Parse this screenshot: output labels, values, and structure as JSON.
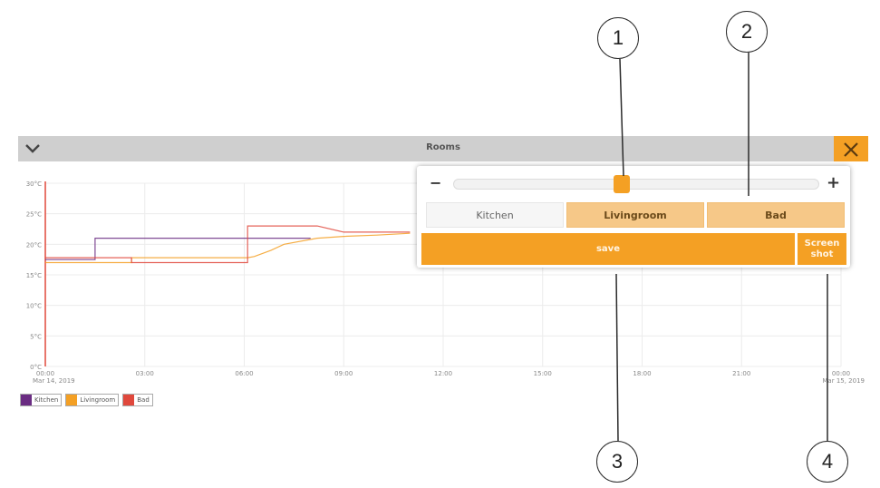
{
  "panel": {
    "title": "Rooms"
  },
  "controls": {
    "zoom_minus": "−",
    "zoom_plus": "+",
    "zoom_level": 0.46,
    "tabs": [
      {
        "label": "Kitchen",
        "selected": false
      },
      {
        "label": "Livingroom",
        "selected": true
      },
      {
        "label": "Bad",
        "selected": true
      }
    ],
    "save_label": "save",
    "screenshot_label": "Screen\nshot"
  },
  "callouts": [
    "1",
    "2",
    "3",
    "4"
  ],
  "colors": {
    "accent": "#f4a024",
    "header": "#cfcfcf",
    "kitchen": "#6a2c82",
    "livingroom": "#f4a024",
    "bad": "#e0483c"
  },
  "icons": {
    "collapse": "chevron-down-icon",
    "close": "close-icon"
  },
  "chart_data": {
    "type": "line",
    "y_ticks": [
      "0°C",
      "5°C",
      "10°C",
      "15°C",
      "20°C",
      "25°C",
      "30°C"
    ],
    "x_ticks": [
      "00:00",
      "03:00",
      "06:00",
      "09:00",
      "12:00",
      "15:00",
      "18:00",
      "21:00",
      "00:00"
    ],
    "x_start_label": "Mar 14, 2019",
    "x_end_label": "Mar 15, 2019",
    "ylim": [
      0,
      30
    ],
    "grid": true,
    "legend_position": "bottom-left",
    "series": [
      {
        "name": "Kitchen",
        "color": "#6a2c82",
        "x": [
          0,
          1.5,
          1.5,
          6.1,
          6.1,
          8
        ],
        "values": [
          17.5,
          17.5,
          21,
          21,
          21,
          21
        ]
      },
      {
        "name": "Livingroom",
        "color": "#f4a024",
        "x": [
          0,
          2.6,
          2.6,
          6.1,
          6.3,
          6.8,
          7.2,
          8.2,
          9,
          10,
          11
        ],
        "values": [
          17,
          17,
          17.8,
          17.8,
          18,
          19,
          20,
          21,
          21.3,
          21.5,
          21.8
        ]
      },
      {
        "name": "Bad",
        "color": "#e0483c",
        "x": [
          0,
          2.6,
          2.6,
          6.1,
          6.1,
          8.2,
          9,
          11
        ],
        "values": [
          17.8,
          17.8,
          17,
          17,
          23,
          23,
          22,
          22
        ]
      }
    ]
  }
}
